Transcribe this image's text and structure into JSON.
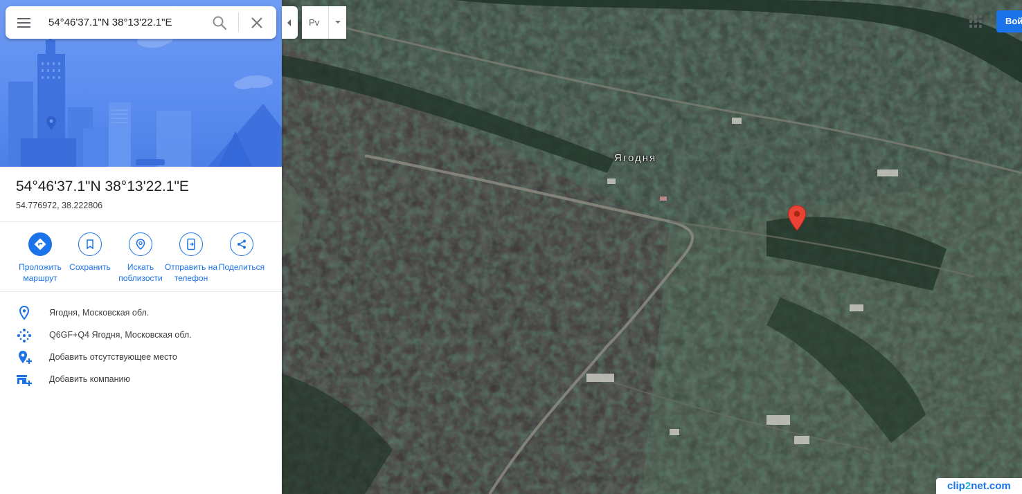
{
  "search": {
    "value": "54°46'37.1\"N 38°13'22.1\"E",
    "placeholder": ""
  },
  "place": {
    "title": "54°46'37.1\"N 38°13'22.1\"E",
    "decimal_coords": "54.776972, 38.222806"
  },
  "actions": [
    {
      "label": "Проложить маршрут",
      "icon": "directions-icon"
    },
    {
      "label": "Сохранить",
      "icon": "bookmark-icon"
    },
    {
      "label": "Искать поблизости",
      "icon": "nearby-icon"
    },
    {
      "label": "Отправить на телефон",
      "icon": "send-to-phone-icon"
    },
    {
      "label": "Поделиться",
      "icon": "share-icon"
    }
  ],
  "info": [
    {
      "text": "Ягодня, Московская обл.",
      "icon": "location-pin-icon"
    },
    {
      "text": "Q6GF+Q4 Ягодня, Московская обл.",
      "icon": "plus-code-icon"
    },
    {
      "text": "Добавить отсутствующее место",
      "icon": "add-place-icon"
    },
    {
      "text": "Добавить компанию",
      "icon": "add-business-icon"
    }
  ],
  "map": {
    "layer_select_value": "Pv",
    "village_label": "Ягодня",
    "signin_label": "Войти"
  },
  "watermark": {
    "part_a": "clip",
    "part_b": "2",
    "part_c": "net.com"
  },
  "colors": {
    "accent": "#1a73e8",
    "pin": "#ea4335",
    "hero": "#5b8cef"
  }
}
